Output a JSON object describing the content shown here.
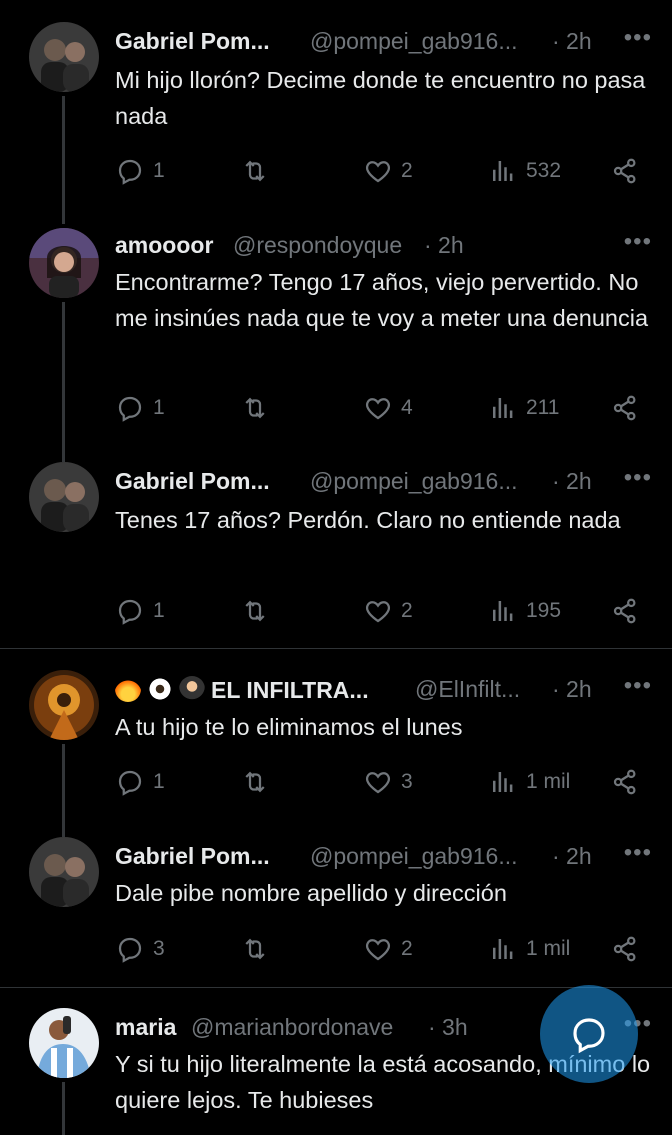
{
  "tweets": [
    {
      "name": "Gabriel Pom...",
      "handle": "@pompei_gab916...",
      "time": "· 2h",
      "text": "Mi hijo llorón? Decime donde te encuentro no pasa nada",
      "replies": "1",
      "likes": "2",
      "views": "532"
    },
    {
      "name": "amoooor",
      "handle": "@respondoyque",
      "time": "· 2h",
      "text": "Encontrarme? Tengo 17 años, viejo pervertido. No me insinúes nada que te voy a meter una denuncia",
      "replies": "1",
      "likes": "4",
      "views": "211"
    },
    {
      "name": "Gabriel Pom...",
      "handle": "@pompei_gab916...",
      "time": "· 2h",
      "text": "Tenes 17 años? Perdón. Claro no entiende nada",
      "replies": "1",
      "likes": "2",
      "views": "195"
    },
    {
      "name": "EL INFILTRA...",
      "handle": "@ElInfilt...",
      "time": "· 2h",
      "text": "A tu hijo te lo eliminamos el lunes",
      "replies": "1",
      "likes": "3",
      "views": "1 mil"
    },
    {
      "name": "Gabriel Pom...",
      "handle": "@pompei_gab916...",
      "time": "· 2h",
      "text": "Dale pibe nombre apellido y dirección",
      "replies": "3",
      "likes": "2",
      "views": "1 mil"
    },
    {
      "name": "maria",
      "handle": "@marianbordonave",
      "time": "· 3h",
      "text": "Y si tu hijo literalmente la está acosando, mínimo lo quiere lejos. Te hubieses"
    }
  ],
  "more_label": "•••",
  "icons": [
    "reply-icon",
    "retweet-icon",
    "like-icon",
    "views-icon",
    "share-icon",
    "compose-icon"
  ],
  "colors": {
    "background": "#000000",
    "text": "#e7e9ea",
    "muted": "#71767b",
    "accent": "#1d9bf0"
  }
}
